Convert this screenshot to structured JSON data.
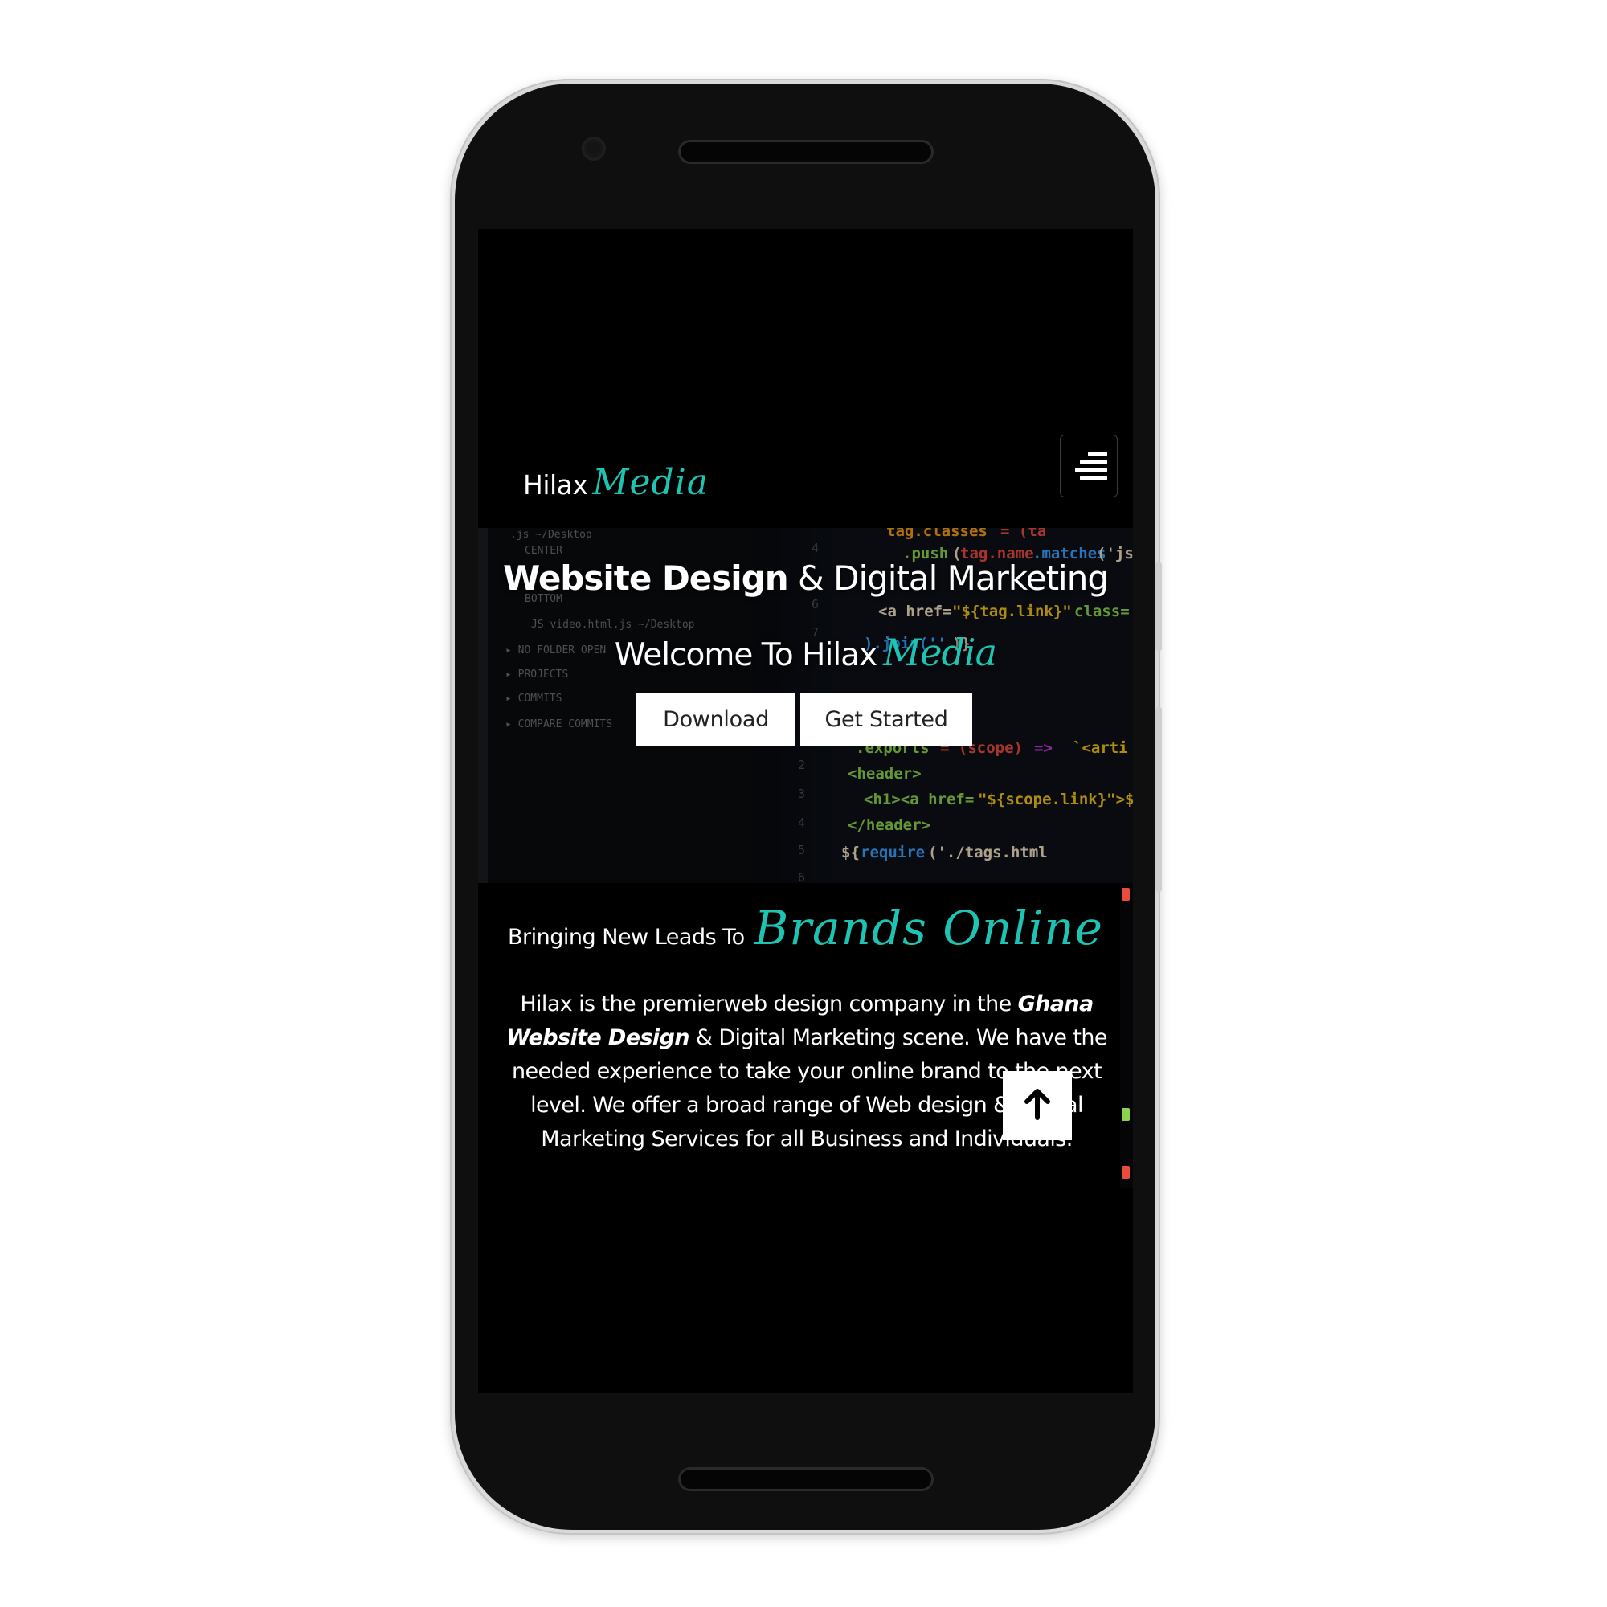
{
  "navbar": {
    "brand_main": "Hilax",
    "brand_script": "Media",
    "menu_icon": "hamburger-menu-icon"
  },
  "hero": {
    "title_bold": "Website Design",
    "title_rest": " & Digital Marketing",
    "subtitle_main": "Welcome To Hilax",
    "subtitle_script": "Media",
    "download_label": "Download",
    "get_started_label": "Get Started"
  },
  "about": {
    "heading_main": "Bringing New Leads To",
    "heading_script": "Brands Online",
    "text_before": "Hilax is the premierweb design company in the ",
    "text_emphasis": "Ghana Website Design",
    "text_after": " & Digital Marketing scene. We have the needed experience to take your online brand to the next level. We offer a broad range of Web design & Digital Marketing Services for all Business and Individuals."
  },
  "scroll_top": {
    "icon": "arrow-up-icon"
  },
  "colors": {
    "accent": "#1ec4b3",
    "background": "#000000",
    "text": "#ffffff",
    "button_bg": "#ffffff",
    "button_text": "#222222"
  }
}
